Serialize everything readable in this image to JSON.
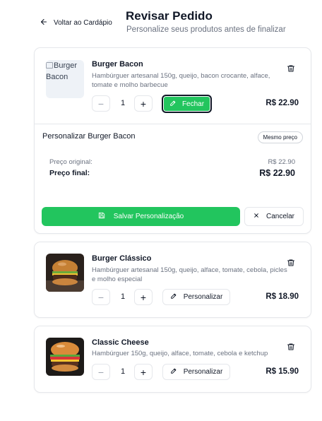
{
  "header": {
    "back_label": "Voltar ao Cardápio",
    "title": "Revisar Pedido",
    "subtitle": "Personalize seus produtos antes de finalizar"
  },
  "items": [
    {
      "name": "Burger Bacon",
      "image_alt": "Burger Bacon",
      "description": "Hambúrguer artesanal 150g, queijo, bacon crocante, alface, tomate e molho barbecue",
      "quantity": "1",
      "action_label": "Fechar",
      "price": "R$ 22.90",
      "customization": {
        "title": "Personalizar Burger Bacon",
        "badge": "Mesmo preço",
        "original_label": "Preço original:",
        "original_value": "R$ 22.90",
        "final_label": "Preço final:",
        "final_value": "R$ 22.90",
        "save_label": "Salvar Personalização",
        "cancel_label": "Cancelar"
      }
    },
    {
      "name": "Burger Clássico",
      "description": "Hambúrguer artesanal 150g, queijo, alface, tomate, cebola, picles e molho especial",
      "quantity": "1",
      "action_label": "Personalizar",
      "price": "R$ 18.90"
    },
    {
      "name": "Classic Cheese",
      "description": "Hambúrguer 150g, queijo, alface, tomate, cebola e ketchup",
      "quantity": "1",
      "action_label": "Personalizar",
      "price": "R$ 15.90"
    }
  ],
  "colors": {
    "accent": "#22c55e",
    "text": "#111827",
    "muted": "#6b7280",
    "border": "#e5e7eb"
  },
  "icons": [
    "arrow-left-icon",
    "trash-icon",
    "pencil-icon",
    "save-icon",
    "close-icon",
    "broken-image-icon"
  ]
}
